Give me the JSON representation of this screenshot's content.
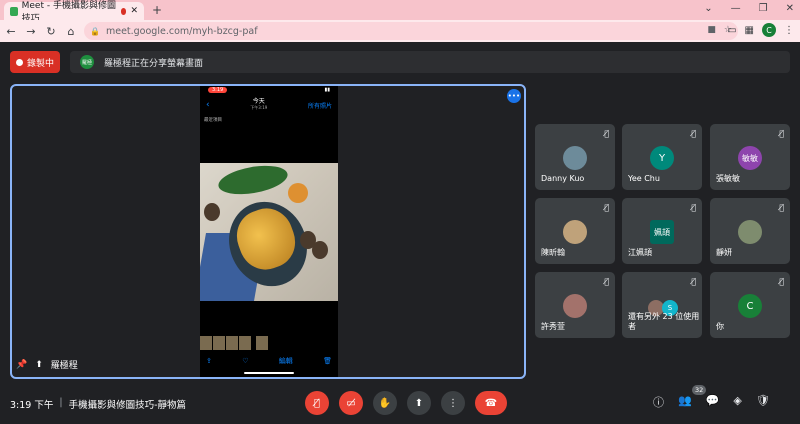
{
  "browser": {
    "tab_title": "Meet - 手機攝影與修圖技巧",
    "url": "meet.google.com/myh-bzcg-paf",
    "profile_initial": "C"
  },
  "meeting": {
    "recording_label": "錄製中",
    "presenter_badge": "羅極",
    "presenting_text": "羅極程正在分享螢幕畫面",
    "stage_name": "羅極程",
    "time": "3:19 下午",
    "title": "手機攝影與修圖技巧-靜物篇",
    "participant_count": "32"
  },
  "phone": {
    "status_time": "3:19",
    "nav_title": "今天",
    "nav_subtitle": "下午3:19",
    "all_photos": "所有照片",
    "location": "最近項目",
    "edit": "編輯"
  },
  "participants": [
    {
      "name": "Danny Kuo",
      "initial": "",
      "color": "#6d8b9a"
    },
    {
      "name": "Yee Chu",
      "initial": "Y",
      "color": "#00897b"
    },
    {
      "name": "張敏敏",
      "initial": "敏敏",
      "color": "#8e44ad"
    },
    {
      "name": "陳昕翰",
      "initial": "",
      "color": "#bfa27a"
    },
    {
      "name": "江姵頡",
      "initial": "姵頡",
      "color": "#00695c"
    },
    {
      "name": "靜妍",
      "initial": "",
      "color": "#7e8c6e"
    },
    {
      "name": "許秀萱",
      "initial": "",
      "color": "#a3726b"
    },
    {
      "name": "還有另外 23 位使用者",
      "initial": "S",
      "color": "#12b5cb"
    },
    {
      "name": "你",
      "initial": "C",
      "color": "#188038"
    }
  ],
  "colors": {
    "accent": "#8ab4f8",
    "danger": "#ea4335",
    "background": "#202124",
    "tile": "#3c4043"
  }
}
